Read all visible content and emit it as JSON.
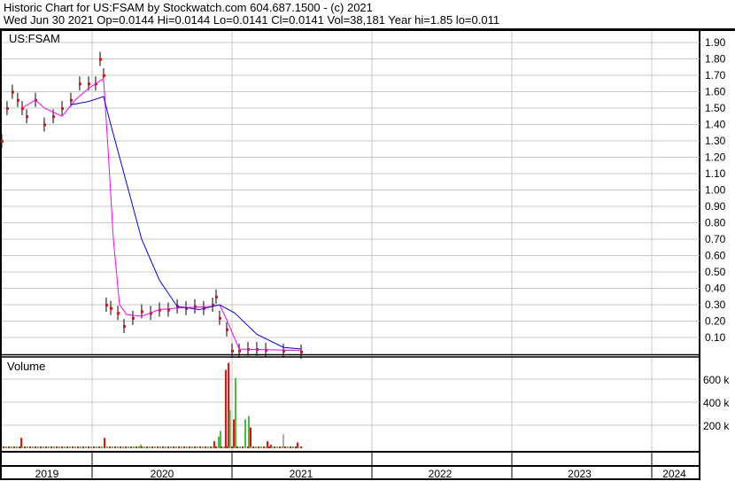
{
  "header": {
    "line1": "Historic Chart for US:FSAM by Stockwatch.com 604.687.1500 - (c) 2021",
    "line2": "Wed Jun 30 2021   Op=0.0144   Hi=0.0144   Lo=0.0141   Cl=0.0141   Vol=38,181   Year hi=1.85   lo=0.011"
  },
  "chart_data": [
    {
      "type": "line",
      "title": "US:FSAM",
      "ylim": [
        0,
        1.95
      ],
      "yticks": [
        "1.90",
        "1.80",
        "1.70",
        "1.60",
        "1.50",
        "1.40",
        "1.30",
        "1.20",
        "1.10",
        "1.00",
        "0.90",
        "0.80",
        "0.70",
        "0.60",
        "0.50",
        "0.40",
        "0.30",
        "0.20",
        "0.10"
      ],
      "xlim": [
        2019.34,
        2024.35
      ],
      "xlabels": [
        "2019",
        "2020",
        "2021",
        "2022",
        "2023",
        "2024"
      ],
      "series": [
        {
          "name": "close",
          "color": "#ff0000",
          "points": [
            [
              2019.354,
              1.3
            ],
            [
              2019.392,
              1.5
            ],
            [
              2019.43,
              1.6
            ],
            [
              2019.468,
              1.55
            ],
            [
              2019.5,
              1.5
            ],
            [
              2019.532,
              1.45
            ],
            [
              2019.595,
              1.55
            ],
            [
              2019.658,
              1.4
            ],
            [
              2019.722,
              1.45
            ],
            [
              2019.785,
              1.5
            ],
            [
              2019.848,
              1.55
            ],
            [
              2019.911,
              1.65
            ],
            [
              2019.975,
              1.65
            ],
            [
              2020.025,
              1.65
            ],
            [
              2020.057,
              1.8
            ],
            [
              2020.082,
              1.7
            ],
            [
              2020.101,
              0.3
            ],
            [
              2020.133,
              0.28
            ],
            [
              2020.184,
              0.25
            ],
            [
              2020.228,
              0.17
            ],
            [
              2020.291,
              0.22
            ],
            [
              2020.354,
              0.26
            ],
            [
              2020.418,
              0.25
            ],
            [
              2020.481,
              0.27
            ],
            [
              2020.544,
              0.27
            ],
            [
              2020.608,
              0.29
            ],
            [
              2020.671,
              0.28
            ],
            [
              2020.734,
              0.29
            ],
            [
              2020.797,
              0.28
            ],
            [
              2020.861,
              0.3
            ],
            [
              2020.886,
              0.35
            ],
            [
              2020.911,
              0.22
            ],
            [
              2020.962,
              0.15
            ],
            [
              2021.0,
              0.02
            ],
            [
              2021.051,
              0.02
            ],
            [
              2021.114,
              0.03
            ],
            [
              2021.177,
              0.03
            ],
            [
              2021.241,
              0.025
            ],
            [
              2021.367,
              0.02
            ],
            [
              2021.494,
              0.014
            ]
          ]
        },
        {
          "name": "ma-short",
          "color": "#ff00ff",
          "points": [
            [
              2019.5,
              1.5
            ],
            [
              2019.595,
              1.55
            ],
            [
              2019.658,
              1.5
            ],
            [
              2019.785,
              1.45
            ],
            [
              2019.88,
              1.55
            ],
            [
              2019.975,
              1.62
            ],
            [
              2020.082,
              1.68
            ],
            [
              2020.114,
              1.25
            ],
            [
              2020.152,
              0.7
            ],
            [
              2020.196,
              0.3
            ],
            [
              2020.247,
              0.24
            ],
            [
              2020.354,
              0.23
            ],
            [
              2020.481,
              0.27
            ],
            [
              2020.608,
              0.28
            ],
            [
              2020.861,
              0.29
            ],
            [
              2020.911,
              0.3
            ],
            [
              2020.956,
              0.22
            ],
            [
              2021.051,
              0.03
            ],
            [
              2021.494,
              0.02
            ]
          ]
        },
        {
          "name": "ma-long",
          "color": "#0000ff",
          "points": [
            [
              2019.848,
              1.52
            ],
            [
              2019.975,
              1.54
            ],
            [
              2020.082,
              1.57
            ],
            [
              2020.133,
              1.4
            ],
            [
              2020.228,
              1.1
            ],
            [
              2020.354,
              0.7
            ],
            [
              2020.481,
              0.45
            ],
            [
              2020.608,
              0.29
            ],
            [
              2020.766,
              0.27
            ],
            [
              2020.911,
              0.3
            ],
            [
              2021.019,
              0.25
            ],
            [
              2021.177,
              0.12
            ],
            [
              2021.367,
              0.04
            ],
            [
              2021.494,
              0.03
            ]
          ]
        }
      ]
    },
    {
      "type": "bar",
      "title": "Volume",
      "ylim": [
        0,
        800000
      ],
      "yticks": [
        "600 k",
        "400 k",
        "200 k"
      ],
      "bars": [
        [
          2019.494,
          90000,
          "#ff0000"
        ],
        [
          2020.089,
          90000,
          "#ff0000"
        ],
        [
          2020.348,
          30000,
          "#44bb44"
        ],
        [
          2020.873,
          60000,
          "#ff0000"
        ],
        [
          2020.905,
          100000,
          "#44bb44"
        ],
        [
          2020.918,
          150000,
          "#44bb44"
        ],
        [
          2020.956,
          680000,
          "#ff0000"
        ],
        [
          2020.975,
          740000,
          "#ff0000"
        ],
        [
          2020.985,
          330000,
          "#44bb44"
        ],
        [
          2021.025,
          610000,
          "#44bb44"
        ],
        [
          2021.013,
          250000,
          "#ff0000"
        ],
        [
          2021.095,
          250000,
          "#44bb44"
        ],
        [
          2021.12,
          280000,
          "#44bb44"
        ],
        [
          2021.133,
          180000,
          "#ff0000"
        ],
        [
          2021.253,
          60000,
          "#ff0000"
        ],
        [
          2021.278,
          30000,
          "#ff0000"
        ],
        [
          2021.367,
          120000,
          "#aaaaaa"
        ],
        [
          2021.468,
          50000,
          "#ff0000"
        ]
      ]
    }
  ]
}
